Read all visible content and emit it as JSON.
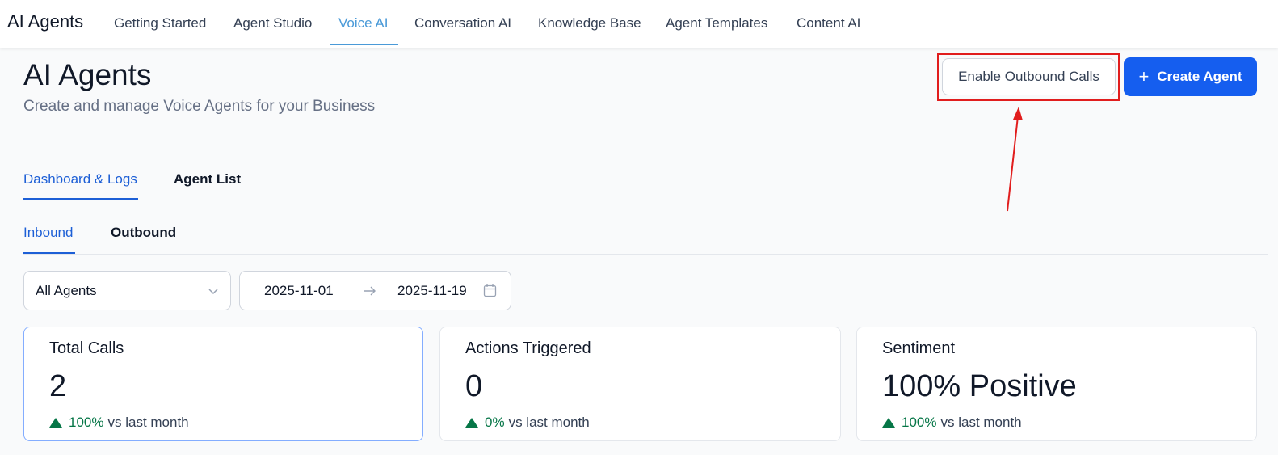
{
  "topnav": {
    "brand": "AI Agents",
    "tabs": [
      {
        "label": "Getting Started"
      },
      {
        "label": "Agent Studio"
      },
      {
        "label": "Voice AI"
      },
      {
        "label": "Conversation AI"
      },
      {
        "label": "Knowledge Base"
      },
      {
        "label": "Agent Templates"
      },
      {
        "label": "Content AI"
      }
    ],
    "active_tab": "Voice AI"
  },
  "header": {
    "title": "AI Agents",
    "subtitle": "Create and manage Voice Agents for your Business",
    "outbound_button": "Enable Outbound Calls",
    "create_button": "Create Agent",
    "create_icon": "plus-icon"
  },
  "main_tabs": [
    {
      "label": "Dashboard & Logs",
      "active": true
    },
    {
      "label": "Agent List",
      "active": false
    }
  ],
  "sub_tabs": [
    {
      "label": "Inbound",
      "active": true
    },
    {
      "label": "Outbound",
      "active": false
    }
  ],
  "filters": {
    "agent_select": "All Agents",
    "date_start": "2025-11-01",
    "date_end": "2025-11-19"
  },
  "cards": [
    {
      "label": "Total Calls",
      "value": "2",
      "trend_pct": "100%",
      "trend_text": "vs last month"
    },
    {
      "label": "Actions Triggered",
      "value": "0",
      "trend_pct": "0%",
      "trend_text": "vs last month"
    },
    {
      "label": "Sentiment",
      "value": "100% Positive",
      "trend_pct": "100%",
      "trend_text": "vs last month"
    }
  ],
  "colors": {
    "primary": "#155eef",
    "nav_active": "#4a9ad8",
    "tab_active": "#1d5fd6",
    "trend_up": "#067647",
    "annotation": "#e11d1d"
  }
}
